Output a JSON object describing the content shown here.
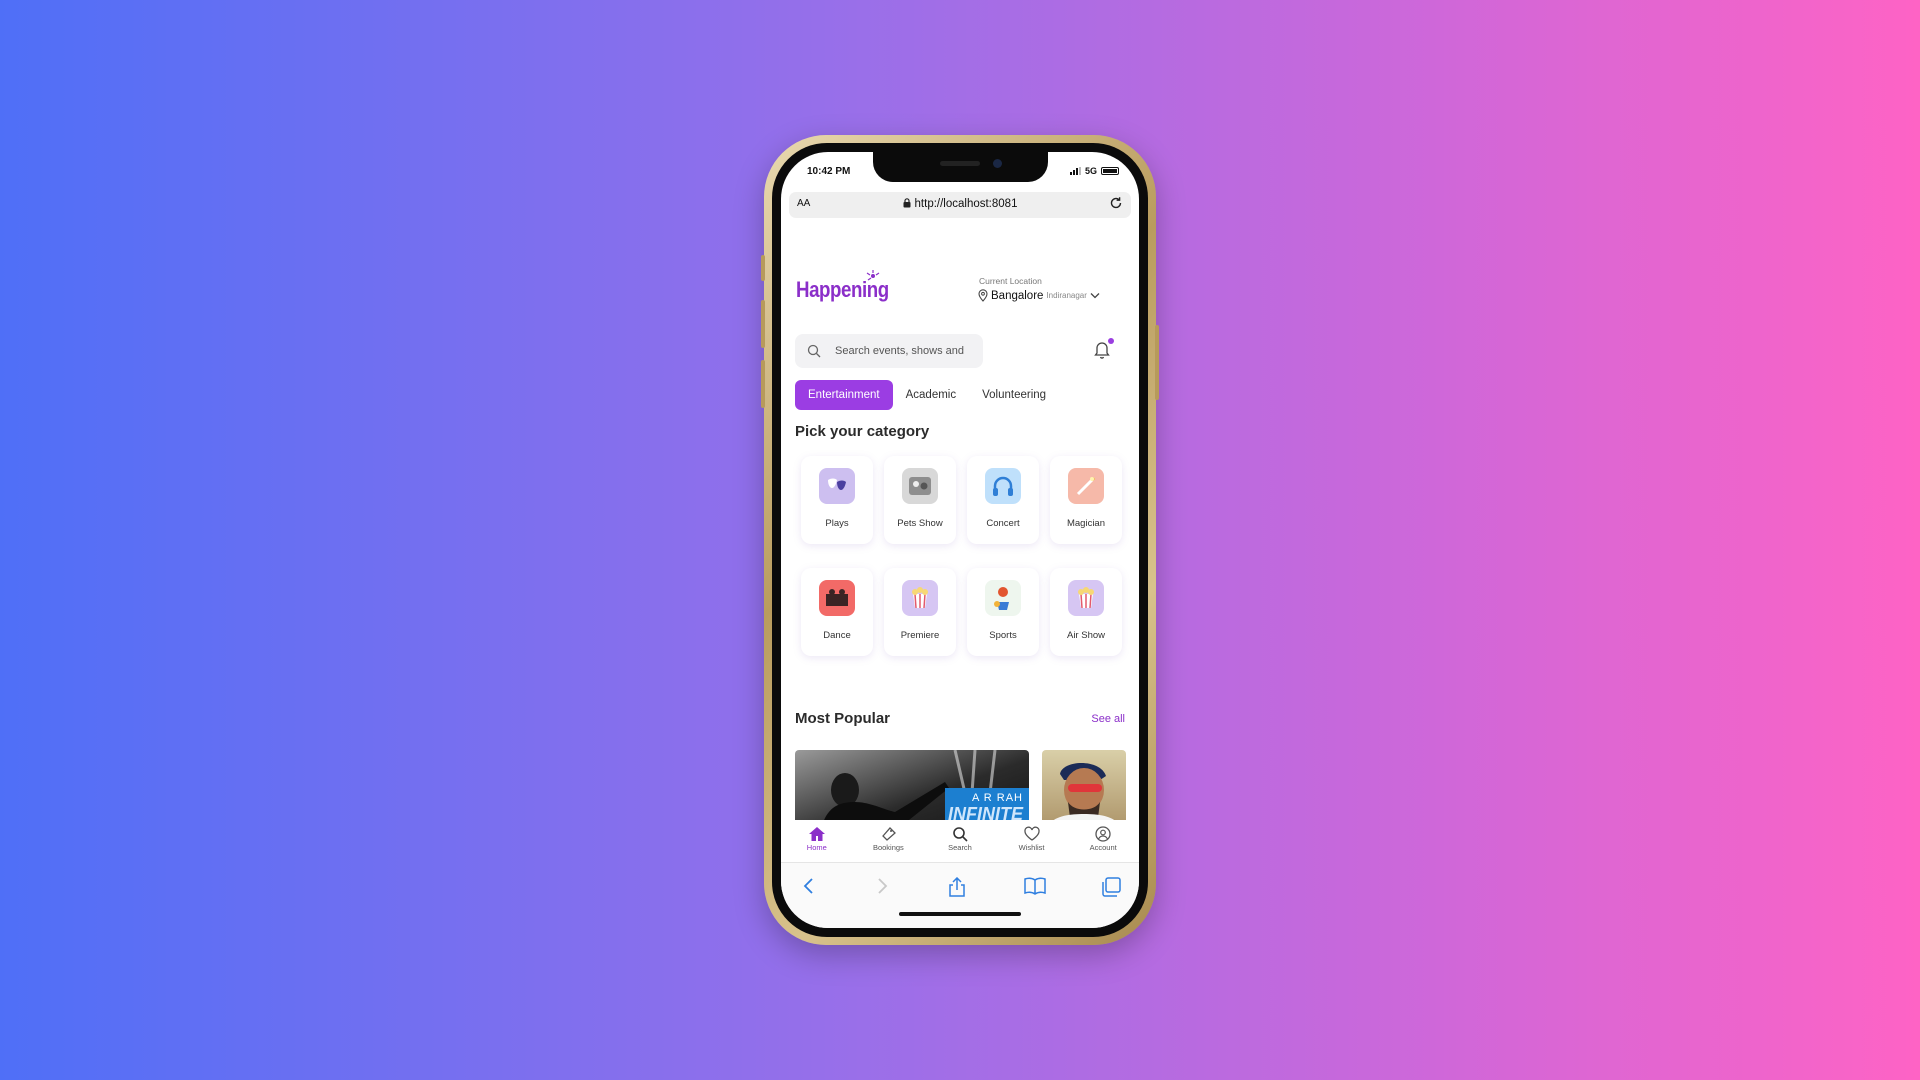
{
  "status_bar": {
    "time": "10:42 PM",
    "network": "5G"
  },
  "browser": {
    "text_size": "AA",
    "url": "http://localhost:8081"
  },
  "header": {
    "brand": "Happening",
    "location_label": "Current Location",
    "city": "Bangalore",
    "area": "Indiranagar"
  },
  "search": {
    "placeholder": "Search events, shows and"
  },
  "tabs": [
    {
      "label": "Entertainment",
      "active": true
    },
    {
      "label": "Academic"
    },
    {
      "label": "Volunteering"
    }
  ],
  "category_section": {
    "title": "Pick your category"
  },
  "categories": [
    {
      "label": "Plays",
      "icon": "masks-icon"
    },
    {
      "label": "Pets Show",
      "icon": "pets-icon"
    },
    {
      "label": "Concert",
      "icon": "headphones-icon"
    },
    {
      "label": "Magician",
      "icon": "magic-wand-icon"
    },
    {
      "label": "Dance",
      "icon": "dance-icon"
    },
    {
      "label": "Premiere",
      "icon": "popcorn-icon"
    },
    {
      "label": "Sports",
      "icon": "sports-icon"
    },
    {
      "label": "Air Show",
      "icon": "popcorn-icon"
    }
  ],
  "popular": {
    "title": "Most Popular",
    "see_all": "See all",
    "cards": [
      {
        "banner_line1": "A R RAH",
        "banner_line2": "INFINITE"
      },
      {
        "subject": "cricket-player"
      }
    ]
  },
  "bottom_nav": [
    {
      "label": "Home",
      "icon": "home-icon",
      "active": true
    },
    {
      "label": "Bookings",
      "icon": "ticket-icon"
    },
    {
      "label": "Search",
      "icon": "search-icon"
    },
    {
      "label": "Wishlist",
      "icon": "heart-icon"
    },
    {
      "label": "Account",
      "icon": "account-icon"
    }
  ],
  "colors": {
    "accent": "#9b3de3",
    "brand": "#8b2fc9"
  }
}
